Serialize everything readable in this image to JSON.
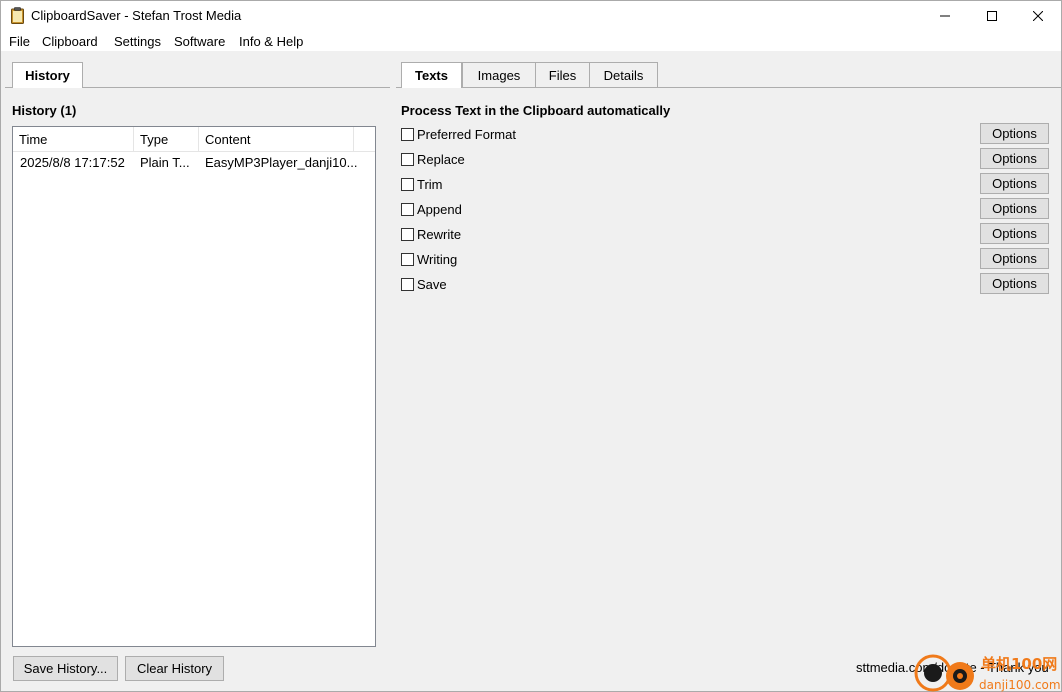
{
  "window": {
    "title": "ClipboardSaver - Stefan Trost Media",
    "minimize_glyph": "—",
    "maximize_glyph": "☐",
    "close_glyph": "✕"
  },
  "menu": [
    "File",
    "Clipboard",
    "Settings",
    "Software",
    "Info & Help"
  ],
  "left_panel": {
    "tab": "History",
    "heading": "History (1)",
    "columns": [
      "Time",
      "Type",
      "Content"
    ],
    "rows": [
      {
        "time": "2025/8/8 17:17:52",
        "type": "Plain T...",
        "content": "EasyMP3Player_danji10..."
      }
    ],
    "save_button": "Save History...",
    "clear_button": "Clear History"
  },
  "right_panel": {
    "tabs": [
      "Texts",
      "Images",
      "Files",
      "Details"
    ],
    "active_tab": "Texts",
    "heading": "Process Text in the Clipboard automatically",
    "options": [
      {
        "label": "Preferred Format",
        "checked": false,
        "button": "Options"
      },
      {
        "label": "Replace",
        "checked": false,
        "button": "Options"
      },
      {
        "label": "Trim",
        "checked": false,
        "button": "Options"
      },
      {
        "label": "Append",
        "checked": false,
        "button": "Options"
      },
      {
        "label": "Rewrite",
        "checked": false,
        "button": "Options"
      },
      {
        "label": "Writing",
        "checked": false,
        "button": "Options"
      },
      {
        "label": "Save",
        "checked": false,
        "button": "Options"
      }
    ]
  },
  "footer": {
    "link": "sttmedia.com/donate - Thank you"
  },
  "watermark": {
    "line1": "单机100网",
    "line2": "danji100.com"
  },
  "colors": {
    "background": "#f0f0f0",
    "button": "#e1e1e1",
    "border": "#adadad",
    "watermark": "#f07a1a"
  }
}
